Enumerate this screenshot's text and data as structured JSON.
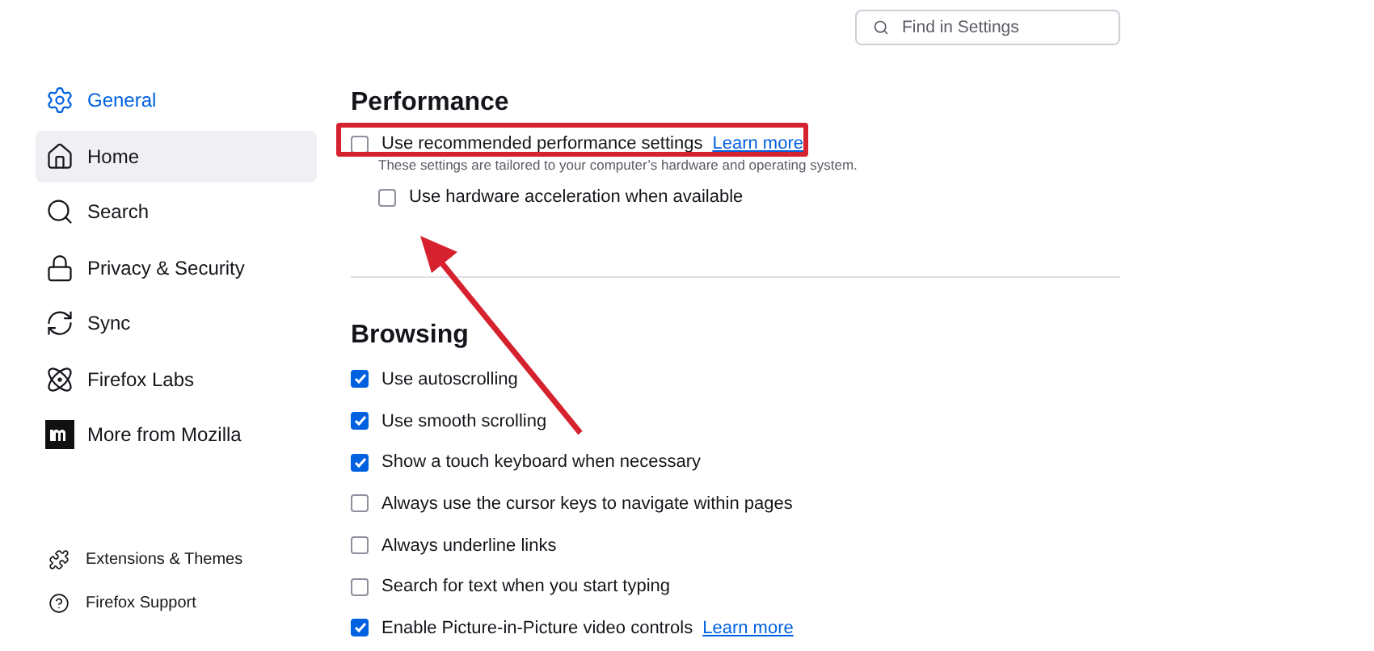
{
  "search": {
    "placeholder": "Find in Settings"
  },
  "sidebar": {
    "items": [
      {
        "label": "General",
        "selected": true,
        "highlighted": false
      },
      {
        "label": "Home",
        "selected": false,
        "highlighted": true
      },
      {
        "label": "Search",
        "selected": false,
        "highlighted": false
      },
      {
        "label": "Privacy & Security",
        "selected": false,
        "highlighted": false
      },
      {
        "label": "Sync",
        "selected": false,
        "highlighted": false
      },
      {
        "label": "Firefox Labs",
        "selected": false,
        "highlighted": false
      },
      {
        "label": "More from Mozilla",
        "selected": false,
        "highlighted": false
      }
    ],
    "footer": [
      {
        "label": "Extensions & Themes"
      },
      {
        "label": "Firefox Support"
      }
    ]
  },
  "sections": [
    {
      "title": "Performance",
      "options": [
        {
          "label": "Use recommended performance settings",
          "checked": false,
          "link": "Learn more",
          "highlighted": true,
          "description": "These settings are tailored to your computer’s hardware and operating system.",
          "children": [
            {
              "label": "Use hardware acceleration when available",
              "checked": false
            }
          ]
        }
      ]
    },
    {
      "title": "Browsing",
      "options": [
        {
          "label": "Use autoscrolling",
          "checked": true
        },
        {
          "label": "Use smooth scrolling",
          "checked": true
        },
        {
          "label": "Show a touch keyboard when necessary",
          "checked": true
        },
        {
          "label": "Always use the cursor keys to navigate within pages",
          "checked": false
        },
        {
          "label": "Always underline links",
          "checked": false
        },
        {
          "label": "Search for text when you start typing",
          "checked": false
        },
        {
          "label": "Enable Picture-in-Picture video controls",
          "checked": true,
          "link": "Learn more"
        }
      ]
    }
  ]
}
